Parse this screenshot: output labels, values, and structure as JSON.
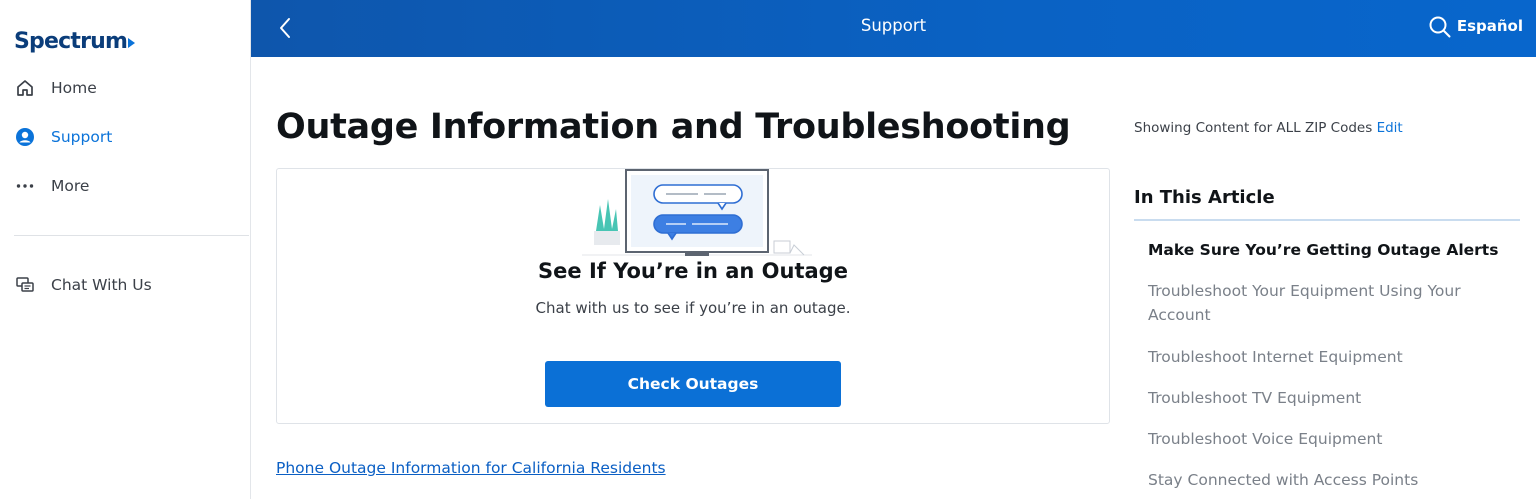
{
  "sidebar": {
    "logo_text": "Spectrum",
    "items": [
      {
        "label": "Home",
        "icon": "home-icon"
      },
      {
        "label": "Support",
        "icon": "support-person-icon"
      },
      {
        "label": "More",
        "icon": "more-dots-icon"
      }
    ],
    "chat": {
      "label": "Chat With Us",
      "icon": "chat-bubbles-icon"
    }
  },
  "topbar": {
    "title": "Support",
    "language": "Español"
  },
  "main": {
    "title": "Outage Information and Troubleshooting",
    "card": {
      "heading": "See If You’re in an Outage",
      "subtext": "Chat with us to see if you’re in an outage.",
      "button": "Check Outages"
    },
    "ca_link": "Phone Outage Information for California Residents"
  },
  "aside": {
    "zip_text": "Showing Content for ALL ZIP Codes",
    "zip_edit": "Edit",
    "toc_title": "In This Article",
    "toc": [
      "Make Sure You’re Getting Outage Alerts",
      "Troubleshoot Your Equipment Using Your Account",
      "Troubleshoot Internet Equipment",
      "Troubleshoot TV Equipment",
      "Troubleshoot Voice Equipment",
      "Stay Connected with Access Points"
    ]
  },
  "colors": {
    "brand_blue": "#0b70d6",
    "topbar_blue": "#0a5fbf",
    "logo_navy": "#0b3d7a"
  }
}
